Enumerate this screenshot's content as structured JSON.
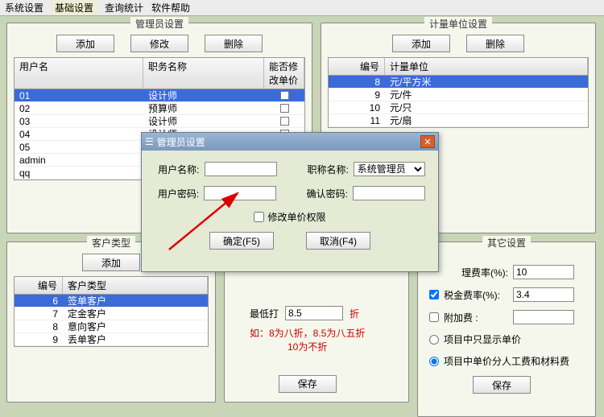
{
  "menu": {
    "sys": "系统设置",
    "base": "基础设置",
    "stats": "查询统计",
    "help": "软件帮助"
  },
  "panels": {
    "admin": {
      "title": "管理员设置",
      "add": "添加",
      "edit": "修改",
      "del": "删除",
      "cols": {
        "c1": "用户名",
        "c2": "职务名称",
        "c3": "能否修改单价"
      },
      "rows": [
        {
          "u": "01",
          "r": "设计师",
          "chk": false,
          "sel": true
        },
        {
          "u": "02",
          "r": "预算师",
          "chk": false
        },
        {
          "u": "03",
          "r": "设计师",
          "chk": false
        },
        {
          "u": "04",
          "r": "设计师",
          "chk": false
        },
        {
          "u": "05",
          "r": "",
          "chk": false
        },
        {
          "u": "admin",
          "r": "",
          "chk": false
        },
        {
          "u": "qq",
          "r": "",
          "chk": false
        }
      ]
    },
    "unit": {
      "title": "计量单位设置",
      "add": "添加",
      "del": "删除",
      "cols": {
        "c1": "编号",
        "c2": "计量单位"
      },
      "rows": [
        {
          "n": "8",
          "v": "元/平方米",
          "sel": true
        },
        {
          "n": "9",
          "v": "元/件"
        },
        {
          "n": "10",
          "v": "元/只"
        },
        {
          "n": "11",
          "v": "元/扇"
        }
      ]
    },
    "cust": {
      "title": "客户类型",
      "add": "添加",
      "cols": {
        "c1": "编号",
        "c2": "客户类型"
      },
      "rows": [
        {
          "n": "6",
          "v": "签单客户",
          "sel": true
        },
        {
          "n": "7",
          "v": "定金客户"
        },
        {
          "n": "8",
          "v": "意向客户"
        },
        {
          "n": "9",
          "v": "丢单客户"
        }
      ]
    },
    "other": {
      "title": "其它设置",
      "mgmt_label": "理费率(%):",
      "mgmt_val": "10",
      "tax_label": "税金费率(%):",
      "tax_val": "3.4",
      "tax_chk": true,
      "extra_label": "附加费 :",
      "extra_val": "",
      "extra_chk": false,
      "opt1": "项目中只显示单价",
      "opt2": "项目中单价分人工费和材料费",
      "opt_sel": 2,
      "save": "保存"
    }
  },
  "discount": {
    "label": "最低打",
    "val": "8.5",
    "suffix": "折",
    "note1": "如：8为八折，8.5为八五折",
    "note2": "10为不折",
    "save": "保存"
  },
  "dialog": {
    "title": "管理员设置",
    "icon": "☰",
    "user": "用户名称:",
    "role": "职称名称:",
    "role_val": "系统管理员",
    "pwd": "用户密码:",
    "pwd2": "确认密码:",
    "chk": "修改单价权限",
    "ok": "确定(F5)",
    "cancel": "取消(F4)"
  }
}
